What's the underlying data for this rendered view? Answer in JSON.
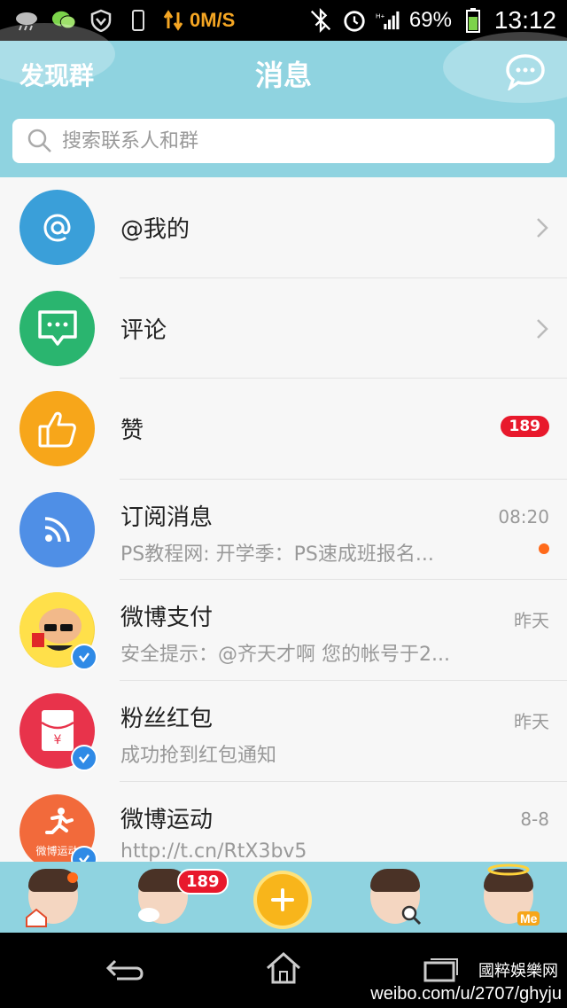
{
  "status_bar": {
    "net_speed": "0M/S",
    "battery_percent": "69%",
    "time": "13:12",
    "icons": [
      "cloud-rain-icon",
      "wechat-icon",
      "shield-icon",
      "phone-icon",
      "data-arrows-icon",
      "bluetooth-off-icon",
      "alarm-icon",
      "signal-icon",
      "battery-icon"
    ]
  },
  "header": {
    "left_label": "发现群",
    "title": "消息",
    "right_icon": "chat-bubble-icon",
    "search_placeholder": "搜索联系人和群"
  },
  "messages": [
    {
      "title": "@我的",
      "icon": "at-icon",
      "color": "#3a9fd9",
      "trailing": "chevron"
    },
    {
      "title": "评论",
      "icon": "comment-icon",
      "color": "#2ab56f",
      "trailing": "chevron"
    },
    {
      "title": "赞",
      "icon": "thumb-up-icon",
      "color": "#f7a61a",
      "badge": "189"
    },
    {
      "title": "订阅消息",
      "icon": "rss-icon",
      "color": "#4f8fe6",
      "subtitle": "PS教程网: 开学季：PS速成班报名...",
      "time": "08:20",
      "unread_dot": true
    },
    {
      "title": "微博支付",
      "icon": "cartoon-avatar-icon",
      "subtitle": "安全提示：@齐天才啊  您的帐号于2...",
      "time": "昨天",
      "verified": true
    },
    {
      "title": "粉丝红包",
      "icon": "red-envelope-icon",
      "color": "#e8334b",
      "subtitle": "成功抢到红包通知",
      "time": "昨天",
      "verified": true
    },
    {
      "title": "微博运动",
      "icon": "runner-icon",
      "color": "#f26a3b",
      "avatar_label": "微博运动",
      "subtitle": "http://t.cn/RtX3bv5",
      "time": "8-8",
      "verified": true
    }
  ],
  "tabbar": {
    "tabs": [
      "home-tab",
      "message-tab",
      "add-tab",
      "discover-tab",
      "profile-tab"
    ],
    "message_badge": "189",
    "profile_label": "Me"
  },
  "watermark": {
    "line1": "國粹娛樂网",
    "line2": "weibo.com/u/2707/ghyju"
  },
  "colors": {
    "header_bg": "#8fd3e0",
    "badge_red": "#e8192c",
    "unread_dot": "#ff6a1a"
  }
}
